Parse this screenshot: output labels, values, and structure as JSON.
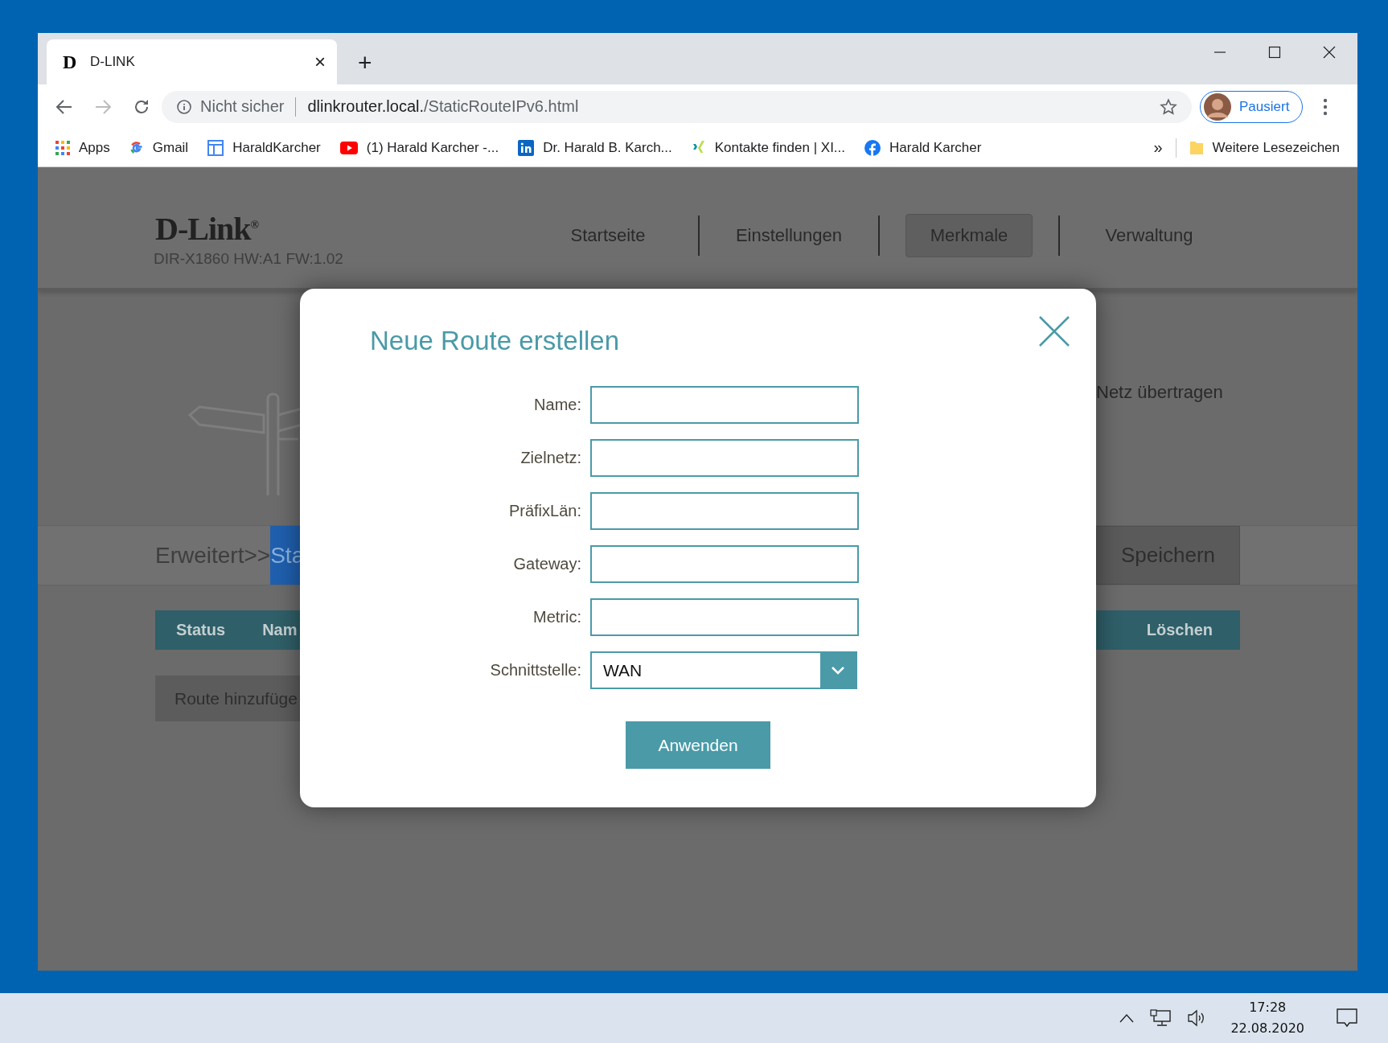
{
  "browser": {
    "tab": {
      "favicon": "D",
      "title": "D-LINK",
      "close": "×"
    },
    "new_tab": "+",
    "address": {
      "security": "Nicht sicher",
      "host": "dlinkrouter.local.",
      "path": "/StaticRouteIPv6.html"
    },
    "profile": {
      "label": "Pausiert"
    },
    "bookmarks": [
      {
        "kind": "apps",
        "label": "Apps"
      },
      {
        "kind": "google",
        "label": "Gmail"
      },
      {
        "kind": "sites",
        "label": "HaraldKarcher"
      },
      {
        "kind": "youtube",
        "label": "(1) Harald Karcher -..."
      },
      {
        "kind": "linkedin",
        "label": "Dr. Harald B. Karch..."
      },
      {
        "kind": "xing",
        "label": "Kontakte finden | XI..."
      },
      {
        "kind": "facebook",
        "label": "Harald Karcher"
      }
    ],
    "overflow": "»",
    "other_bookmarks": "Weitere Lesezeichen"
  },
  "router": {
    "brand": "D-Link$^{®}$",
    "model": "DIR-X1860 HW:A1 FW:1.02",
    "nav": [
      {
        "label": "Startseite",
        "selected": false
      },
      {
        "label": "Einstellungen",
        "selected": false
      },
      {
        "label": "Merkmale",
        "selected": true
      },
      {
        "label": "Verwaltung",
        "selected": false
      }
    ],
    "description_fragment": "Netz übertragen",
    "breadcrumb": {
      "prefix": "Erweitert>>",
      "current": "Sta"
    },
    "save_button": "Speichern",
    "table_columns": [
      "Status",
      "Nam",
      "Löschen"
    ],
    "add_button": "Route hinzufüge"
  },
  "dialog": {
    "title": "Neue Route erstellen",
    "fields": [
      {
        "label": "Name:",
        "kind": "text"
      },
      {
        "label": "Zielnetz:",
        "kind": "text"
      },
      {
        "label": "PräfixLän:",
        "kind": "text"
      },
      {
        "label": "Gateway:",
        "kind": "text"
      },
      {
        "label": "Metric:",
        "kind": "text"
      },
      {
        "label": "Schnittstelle:",
        "kind": "select",
        "value": "WAN"
      }
    ],
    "apply_button": "Anwenden"
  },
  "taskbar": {
    "time": "17:28",
    "date": "22.08.2020"
  }
}
